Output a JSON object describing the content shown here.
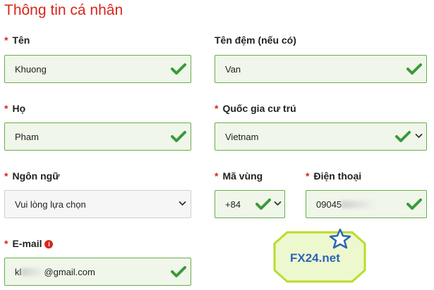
{
  "page": {
    "title": "Thông tin cá nhân"
  },
  "colors": {
    "accent": "#d9261c",
    "valid": "#3a9a3a",
    "valid_bg": "#f0f6ea",
    "valid_border": "#66b04a"
  },
  "form": {
    "first_name": {
      "label": "Tên",
      "value": "Khuong",
      "required": "*",
      "icon": "check-icon"
    },
    "middle_name": {
      "label": "Tên đệm (nếu có)",
      "value": "Van",
      "icon": "check-icon"
    },
    "last_name": {
      "label": "Họ",
      "value": "Pham",
      "required": "*",
      "icon": "check-icon"
    },
    "country": {
      "label": "Quốc gia cư trú",
      "value": "Vietnam",
      "required": "*",
      "icon": "check-icon"
    },
    "language": {
      "label": "Ngôn ngữ",
      "value": "Vui lòng lựa chọn",
      "required": "*"
    },
    "area_code": {
      "label": "Mã vùng",
      "value": "+84",
      "required": "*",
      "icon": "check-icon"
    },
    "phone": {
      "label": "Điện thoại",
      "value": "09045",
      "required": "*",
      "icon": "check-icon"
    },
    "email": {
      "label": "E-mail",
      "value_start": "kl",
      "value_end": "@gmail.com",
      "required": "*",
      "info_icon": "i"
    }
  },
  "watermark": {
    "text": "FX24.net",
    "icon": "star-icon"
  }
}
